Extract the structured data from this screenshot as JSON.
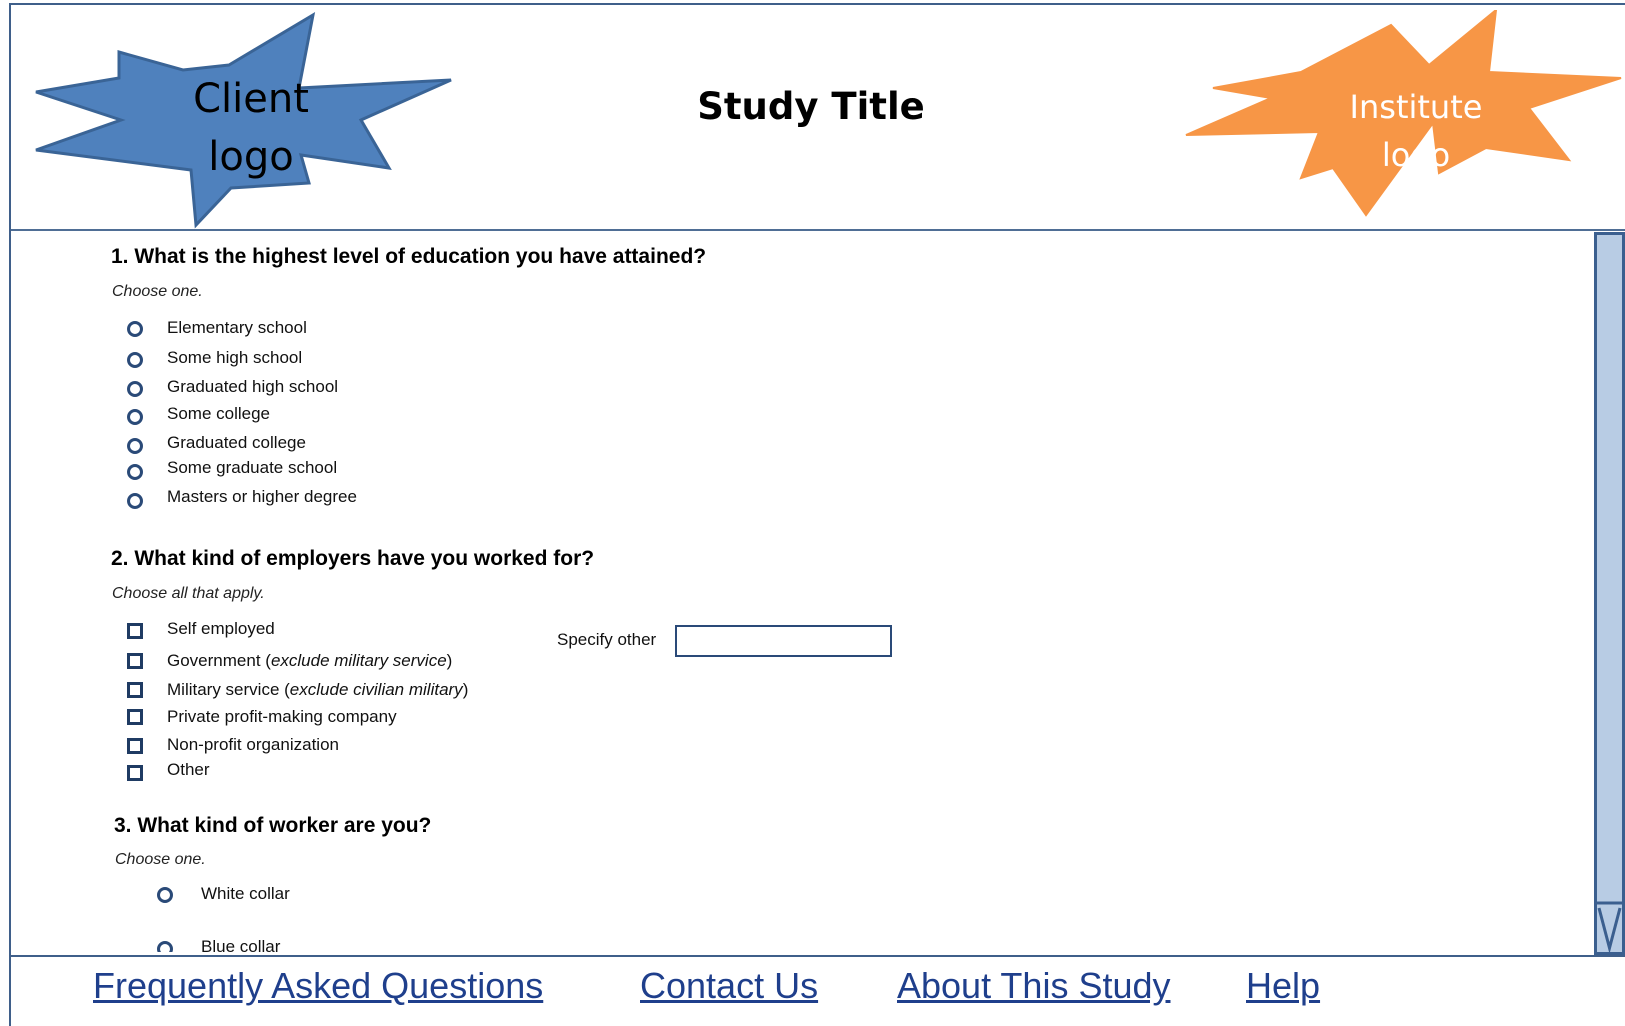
{
  "header": {
    "client_logo": "Client\nlogo",
    "study_title": "Study Title",
    "institute_logo": "Institute\nlogo"
  },
  "colors": {
    "client_logo": "#4f81bd",
    "institute_logo": "#f79646",
    "border": "#3f5f8a",
    "scrollbar": "#b8cce4",
    "link": "#1f3f8c"
  },
  "questions": [
    {
      "title": "1. What is the highest level of education you have attained?",
      "note": "Choose one.",
      "control": "radio",
      "options": [
        "Elementary school",
        "Some high school",
        "Graduated high school",
        "Some college",
        "Graduated college",
        "Some graduate school",
        "Masters or higher degree"
      ]
    },
    {
      "title": "2. What kind of employers have you worked for?",
      "note": "Choose all that apply.",
      "control": "checkbox",
      "options": [
        {
          "text": "Self employed",
          "qualifier": ""
        },
        {
          "text": "Government (",
          "qualifier": "exclude military service",
          "suffix": ")"
        },
        {
          "text": "Military service (",
          "qualifier": "exclude civilian military",
          "suffix": ")"
        },
        {
          "text": "Private profit-making company",
          "qualifier": ""
        },
        {
          "text": "Non-profit organization",
          "qualifier": ""
        },
        {
          "text": "Other",
          "qualifier": ""
        }
      ],
      "specify_other_label": "Specify other",
      "specify_other_value": ""
    },
    {
      "title": "3. What kind of worker are you?",
      "note": "Choose one.",
      "control": "radio",
      "options": [
        "White collar",
        "Blue collar"
      ]
    }
  ],
  "scrollbar": {
    "icon": "scroll-down-arrow-icon"
  },
  "footer": {
    "links": [
      "Frequently Asked Questions",
      "Contact Us",
      "About This Study",
      "Help"
    ]
  }
}
